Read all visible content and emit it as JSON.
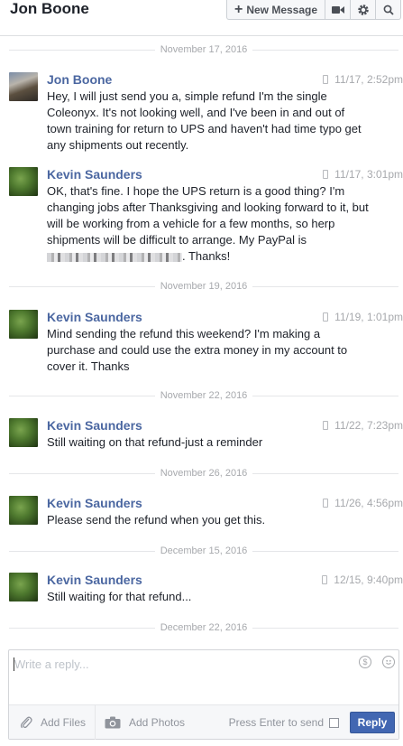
{
  "header": {
    "title": "Jon Boone",
    "new_message_label": "New Message",
    "icons": [
      "video-camera-icon",
      "gear-icon",
      "search-icon"
    ]
  },
  "thread": {
    "date_separators": [
      "November 17, 2016",
      "November 19, 2016",
      "November 22, 2016",
      "November 26, 2016",
      "December 15, 2016",
      "December 22, 2016"
    ],
    "messages": [
      {
        "sender": "Jon Boone",
        "time": "11/17, 2:52pm",
        "text": "Hey, I will just send you a, simple refund I'm the single Coleonyx.  It's not looking well, and I've been in and out of town training for return to UPS and haven't had time typo get any shipments out recently."
      },
      {
        "sender": "Kevin Saunders",
        "time": "11/17, 3:01pm",
        "text": "OK, that's fine. I hope the UPS return is a good thing? I'm changing jobs after Thanksgiving and looking forward to it, but will be working from a vehicle for a few months, so herp shipments will be difficult to arrange. My PayPal is",
        "text_after_redaction": ". Thanks!"
      },
      {
        "sender": "Kevin Saunders",
        "time": "11/19, 1:01pm",
        "text": "Mind sending the refund this weekend? I'm making a purchase and could use the extra money in my account to cover it. Thanks"
      },
      {
        "sender": "Kevin Saunders",
        "time": "11/22, 7:23pm",
        "text": "Still waiting on that refund-just a reminder"
      },
      {
        "sender": "Kevin Saunders",
        "time": "11/26, 4:56pm",
        "text": "Please send the refund when you get this."
      },
      {
        "sender": "Kevin Saunders",
        "time": "12/15, 9:40pm",
        "text": "Still waiting for that refund..."
      }
    ]
  },
  "composer": {
    "placeholder": "Write a reply...",
    "add_files_label": "Add Files",
    "add_photos_label": "Add Photos",
    "press_enter_label": "Press Enter to send",
    "reply_label": "Reply"
  },
  "colors": {
    "sender_name": "#4b67a1",
    "reply_button": "#4267b2",
    "meta_text": "#a7a9ad"
  }
}
